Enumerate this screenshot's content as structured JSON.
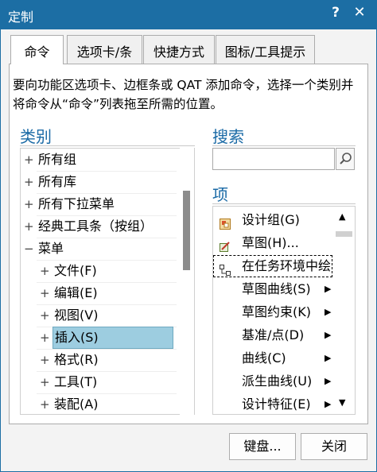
{
  "window": {
    "title": "定制",
    "help_glyph": "?",
    "close_glyph": "✕"
  },
  "tabs": [
    {
      "label": "命令",
      "active": true
    },
    {
      "label": "选项卡/条",
      "active": false
    },
    {
      "label": "快捷方式",
      "active": false
    },
    {
      "label": "图标/工具提示",
      "active": false
    }
  ],
  "description": "要向功能区选项卡、边框条或 QAT 添加命令，选择一个类别并将命令从“命令”列表拖至所需的位置。",
  "categories": {
    "title": "类别",
    "items": [
      {
        "label": "所有组",
        "indent": 0,
        "expander": "+",
        "selected": false
      },
      {
        "label": "所有库",
        "indent": 0,
        "expander": "+",
        "selected": false
      },
      {
        "label": "所有下拉菜单",
        "indent": 0,
        "expander": "+",
        "selected": false
      },
      {
        "label": "经典工具条（按组）",
        "indent": 0,
        "expander": "+",
        "selected": false
      },
      {
        "label": "菜单",
        "indent": 0,
        "expander": "−",
        "selected": false
      },
      {
        "label": "文件(F)",
        "indent": 1,
        "expander": "+",
        "selected": false
      },
      {
        "label": "编辑(E)",
        "indent": 1,
        "expander": "+",
        "selected": false
      },
      {
        "label": "视图(V)",
        "indent": 1,
        "expander": "+",
        "selected": false
      },
      {
        "label": "插入(S)",
        "indent": 1,
        "expander": "+",
        "selected": true
      },
      {
        "label": "格式(R)",
        "indent": 1,
        "expander": "+",
        "selected": false
      },
      {
        "label": "工具(T)",
        "indent": 1,
        "expander": "+",
        "selected": false
      },
      {
        "label": "装配(A)",
        "indent": 1,
        "expander": "+",
        "selected": false
      }
    ]
  },
  "search": {
    "title": "搜索",
    "value": "",
    "placeholder": ""
  },
  "items_section": {
    "title": "项",
    "items": [
      {
        "label": "设计组(G)",
        "icon": "design-group-icon",
        "submenu": false,
        "focused": false
      },
      {
        "label": "草图(H)...",
        "icon": "sketch-icon",
        "submenu": false,
        "focused": false
      },
      {
        "label": "在任务环境中绘",
        "icon": "task-environment-icon",
        "submenu": false,
        "focused": true
      },
      {
        "label": "草图曲线(S)",
        "icon": "",
        "submenu": true,
        "focused": false
      },
      {
        "label": "草图约束(K)",
        "icon": "",
        "submenu": true,
        "focused": false
      },
      {
        "label": "基准/点(D)",
        "icon": "",
        "submenu": true,
        "focused": false
      },
      {
        "label": "曲线(C)",
        "icon": "",
        "submenu": true,
        "focused": false
      },
      {
        "label": "派生曲线(U)",
        "icon": "",
        "submenu": true,
        "focused": false
      },
      {
        "label": "设计特征(E)",
        "icon": "",
        "submenu": true,
        "focused": false
      }
    ]
  },
  "buttons": {
    "keyboard": "键盘...",
    "close": "关闭"
  },
  "colors": {
    "titlebar": "#1c6ea4",
    "section_title": "#1a6aa6",
    "selection": "#9dcde0"
  }
}
